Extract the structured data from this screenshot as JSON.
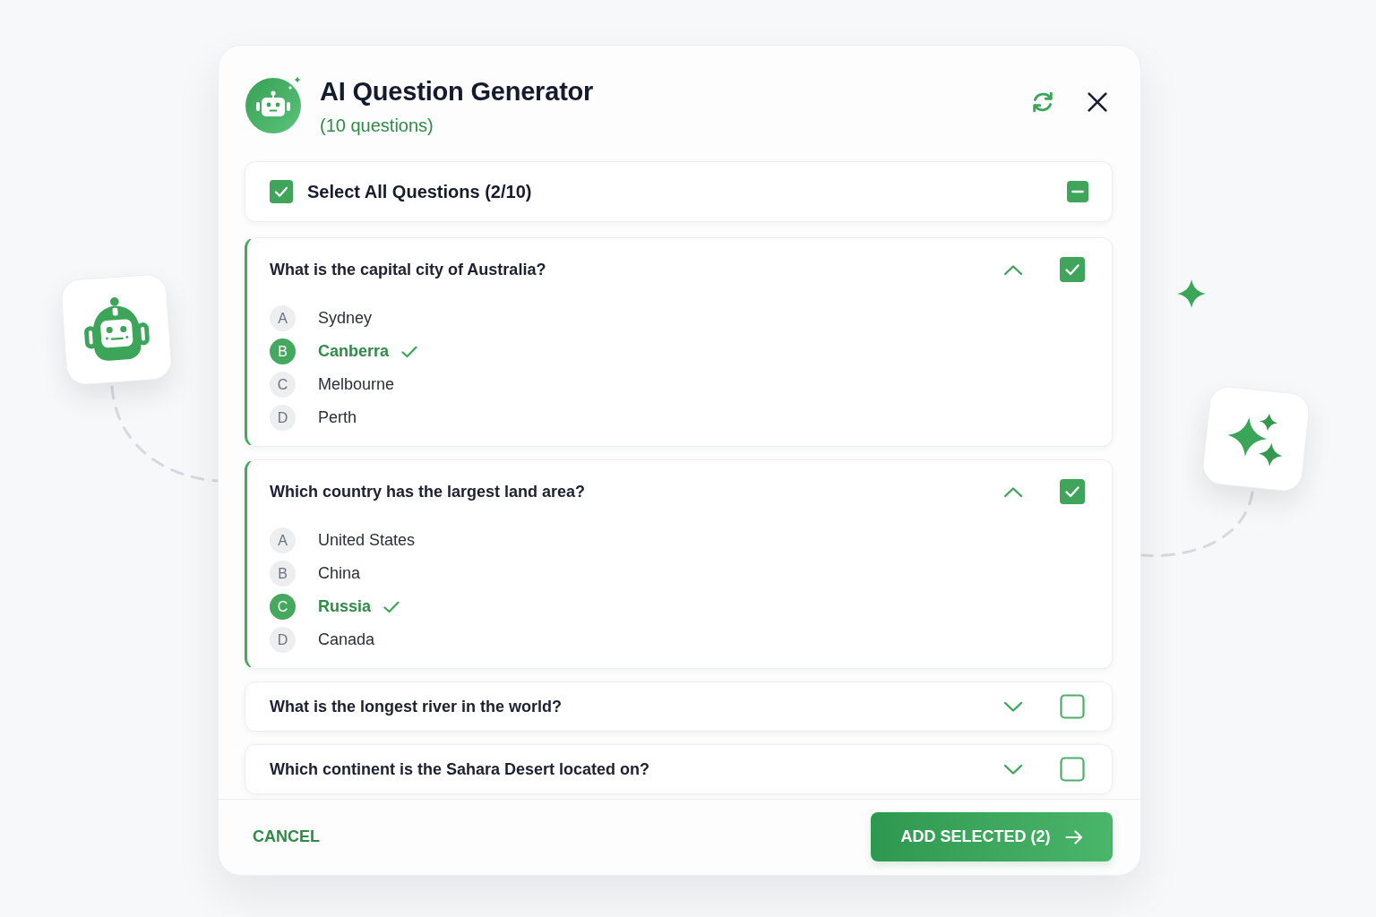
{
  "dialog": {
    "title": "AI Question Generator",
    "subtitle": "(10 questions)"
  },
  "select_all": {
    "label": "Select All Questions (2/10)",
    "checked": true,
    "partial": true
  },
  "questions": [
    {
      "question": "What is the capital city of Australia?",
      "expanded": true,
      "checked": true,
      "options": [
        {
          "letter": "A",
          "text": "Sydney",
          "correct": false
        },
        {
          "letter": "B",
          "text": "Canberra",
          "correct": true
        },
        {
          "letter": "C",
          "text": "Melbourne",
          "correct": false
        },
        {
          "letter": "D",
          "text": "Perth",
          "correct": false
        }
      ]
    },
    {
      "question": "Which country has the largest land area?",
      "expanded": true,
      "checked": true,
      "options": [
        {
          "letter": "A",
          "text": "United States",
          "correct": false
        },
        {
          "letter": "B",
          "text": "China",
          "correct": false
        },
        {
          "letter": "C",
          "text": "Russia",
          "correct": true
        },
        {
          "letter": "D",
          "text": "Canada",
          "correct": false
        }
      ]
    },
    {
      "question": "What is the longest river in the world?",
      "expanded": false,
      "checked": false
    },
    {
      "question": "Which continent is the Sahara Desert located on?",
      "expanded": false,
      "checked": false
    }
  ],
  "footer": {
    "cancel": "CANCEL",
    "confirm": "ADD SELECTED (2)"
  }
}
